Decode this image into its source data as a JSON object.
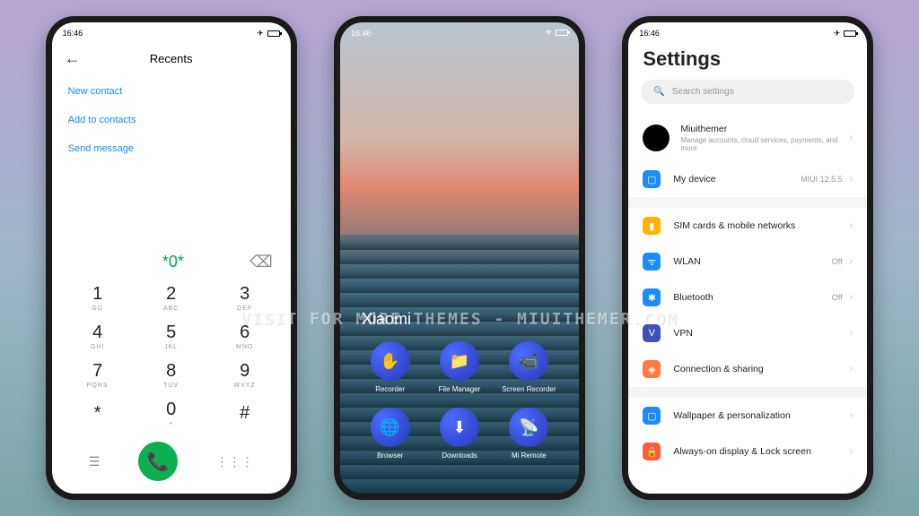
{
  "status_time": "16:46",
  "dialer": {
    "title": "Recents",
    "new_contact": "New contact",
    "add_contacts": "Add to contacts",
    "send_message": "Send message",
    "dialed": "*0*",
    "keys": [
      {
        "n": "1",
        "s": "GD"
      },
      {
        "n": "2",
        "s": "ABC"
      },
      {
        "n": "3",
        "s": "DEF"
      },
      {
        "n": "4",
        "s": "GHI"
      },
      {
        "n": "5",
        "s": "JKL"
      },
      {
        "n": "6",
        "s": "MNO"
      },
      {
        "n": "7",
        "s": "PQRS"
      },
      {
        "n": "8",
        "s": "TUV"
      },
      {
        "n": "9",
        "s": "WXYZ"
      },
      {
        "n": "*",
        "s": ""
      },
      {
        "n": "0",
        "s": "+"
      },
      {
        "n": "#",
        "s": ""
      }
    ]
  },
  "home": {
    "brand": "Xiaomi",
    "apps": [
      {
        "label": "Recorder",
        "icon": "✋"
      },
      {
        "label": "File Manager",
        "icon": "📁"
      },
      {
        "label": "Screen Recorder",
        "icon": "📹"
      },
      {
        "label": "Browser",
        "icon": "🌐"
      },
      {
        "label": "Downloads",
        "icon": "⬇"
      },
      {
        "label": "Mi Remote",
        "icon": "📡"
      }
    ]
  },
  "settings": {
    "title": "Settings",
    "search_placeholder": "Search settings",
    "account_name": "Miuithemer",
    "account_sub": "Manage accounts, cloud services, payments, and more",
    "device_label": "My device",
    "device_version": "MIUI 12.5.5",
    "items": [
      {
        "label": "SIM cards & mobile networks",
        "right": "",
        "color": "#ffb300",
        "icon": "▮"
      },
      {
        "label": "WLAN",
        "right": "Off",
        "color": "#1a8cff",
        "icon": "ᯤ"
      },
      {
        "label": "Bluetooth",
        "right": "Off",
        "color": "#1a8cff",
        "icon": "✱"
      },
      {
        "label": "VPN",
        "right": "",
        "color": "#3f51b5",
        "icon": "V"
      },
      {
        "label": "Connection & sharing",
        "right": "",
        "color": "#ff7a3d",
        "icon": "◈"
      }
    ],
    "more": [
      {
        "label": "Wallpaper & personalization",
        "color": "#1a8cff",
        "icon": "▢"
      },
      {
        "label": "Always-on display & Lock screen",
        "color": "#ff5a3d",
        "icon": "🔒"
      }
    ]
  },
  "watermark": "VISIT FOR MORE THEMES - MIUITHEMER.COM"
}
